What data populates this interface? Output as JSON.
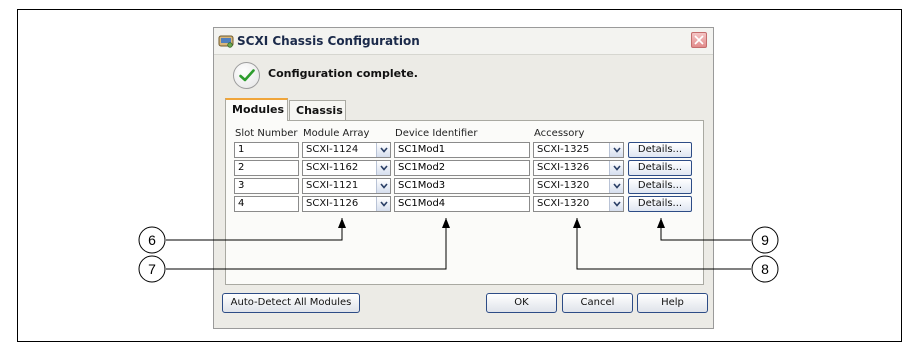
{
  "dialog": {
    "title": "SCXI Chassis Configuration",
    "status_message": "Configuration complete.",
    "tabs": [
      {
        "label": "Modules",
        "active": true
      },
      {
        "label": "Chassis",
        "active": false
      }
    ],
    "columns": {
      "slot_number": "Slot Number",
      "module_array": "Module Array",
      "device_identifier": "Device Identifier",
      "accessory": "Accessory"
    },
    "rows": [
      {
        "slot": "1",
        "module": "SCXI-1124",
        "device": "SC1Mod1",
        "accessory": "SCXI-1325",
        "details": "Details..."
      },
      {
        "slot": "2",
        "module": "SCXI-1162",
        "device": "SC1Mod2",
        "accessory": "SCXI-1326",
        "details": "Details..."
      },
      {
        "slot": "3",
        "module": "SCXI-1121",
        "device": "SC1Mod3",
        "accessory": "SCXI-1320",
        "details": "Details..."
      },
      {
        "slot": "4",
        "module": "SCXI-1126",
        "device": "SC1Mod4",
        "accessory": "SCXI-1320",
        "details": "Details..."
      }
    ],
    "buttons": {
      "auto_detect": "Auto-Detect All Modules",
      "ok": "OK",
      "cancel": "Cancel",
      "help": "Help"
    }
  },
  "callouts": [
    "6",
    "7",
    "8",
    "9"
  ],
  "icons": {
    "app": "chassis-config-icon",
    "close": "close-icon",
    "status": "checkmark-icon",
    "dropdown": "chevron-down-icon"
  },
  "colors": {
    "active_tab_accent": "#f0a53a",
    "check_green": "#2e9d2e",
    "close_button": "#e28b8b",
    "button_border": "#2d4c86"
  }
}
